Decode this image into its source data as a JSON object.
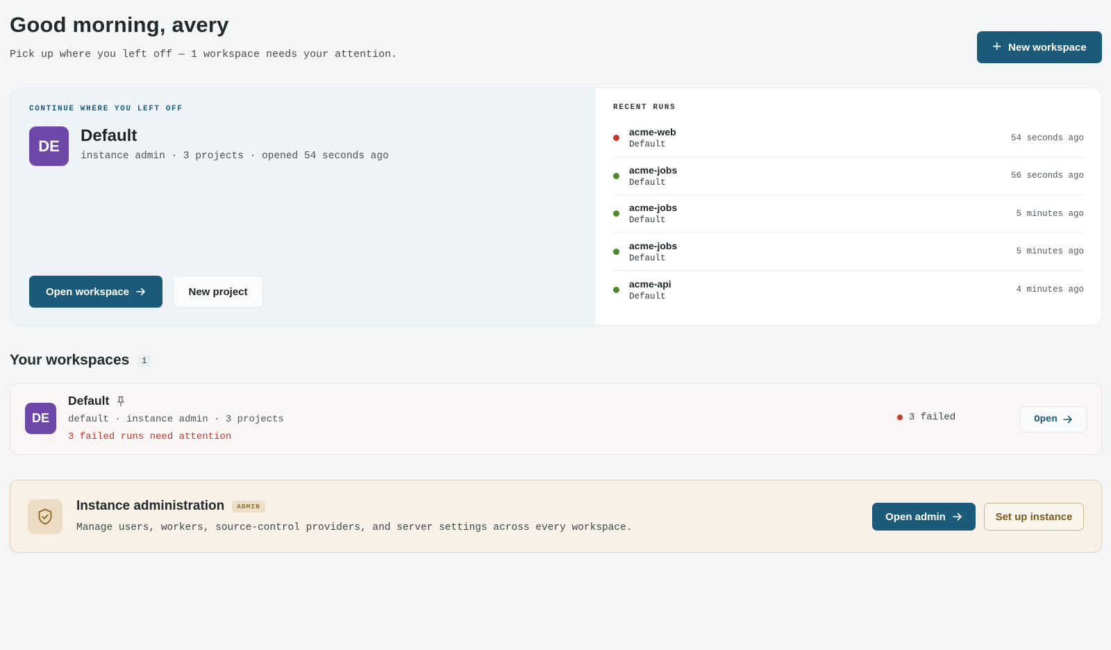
{
  "header": {
    "greeting": "Good morning, avery",
    "subtitle": "Pick up where you left off — 1 workspace needs your attention.",
    "new_workspace_label": "New workspace"
  },
  "continue": {
    "eyebrow": "CONTINUE WHERE YOU LEFT OFF",
    "avatar": "DE",
    "title": "Default",
    "meta": "instance admin · 3 projects · opened 54 seconds ago",
    "open_label": "Open workspace",
    "new_project_label": "New project"
  },
  "recent_runs": {
    "eyebrow": "RECENT RUNS",
    "items": [
      {
        "name": "acme-web",
        "workspace": "Default",
        "time": "54 seconds ago",
        "status": "failed",
        "color": "#c23b2f"
      },
      {
        "name": "acme-jobs",
        "workspace": "Default",
        "time": "56 seconds ago",
        "status": "success",
        "color": "#4e8a2a"
      },
      {
        "name": "acme-jobs",
        "workspace": "Default",
        "time": "5 minutes ago",
        "status": "success",
        "color": "#4e8a2a"
      },
      {
        "name": "acme-jobs",
        "workspace": "Default",
        "time": "5 minutes ago",
        "status": "success",
        "color": "#4e8a2a"
      },
      {
        "name": "acme-api",
        "workspace": "Default",
        "time": "4 minutes ago",
        "status": "success",
        "color": "#4e8a2a"
      }
    ]
  },
  "workspaces": {
    "title": "Your workspaces",
    "count": "1",
    "items": [
      {
        "avatar": "DE",
        "title": "Default",
        "meta": "default · instance admin · 3 projects",
        "alert": "3 failed runs need attention",
        "failed": "3 failed",
        "open_label": "Open"
      }
    ]
  },
  "admin": {
    "title": "Instance administration",
    "badge": "ADMIN",
    "description": "Manage users, workers, source-control providers, and server settings across every workspace.",
    "open_label": "Open admin",
    "setup_label": "Set up instance"
  },
  "colors": {
    "accent": "#1c5a79",
    "avatar": "#6e48a8",
    "failed": "#c23b2f",
    "success": "#4e8a2a"
  }
}
